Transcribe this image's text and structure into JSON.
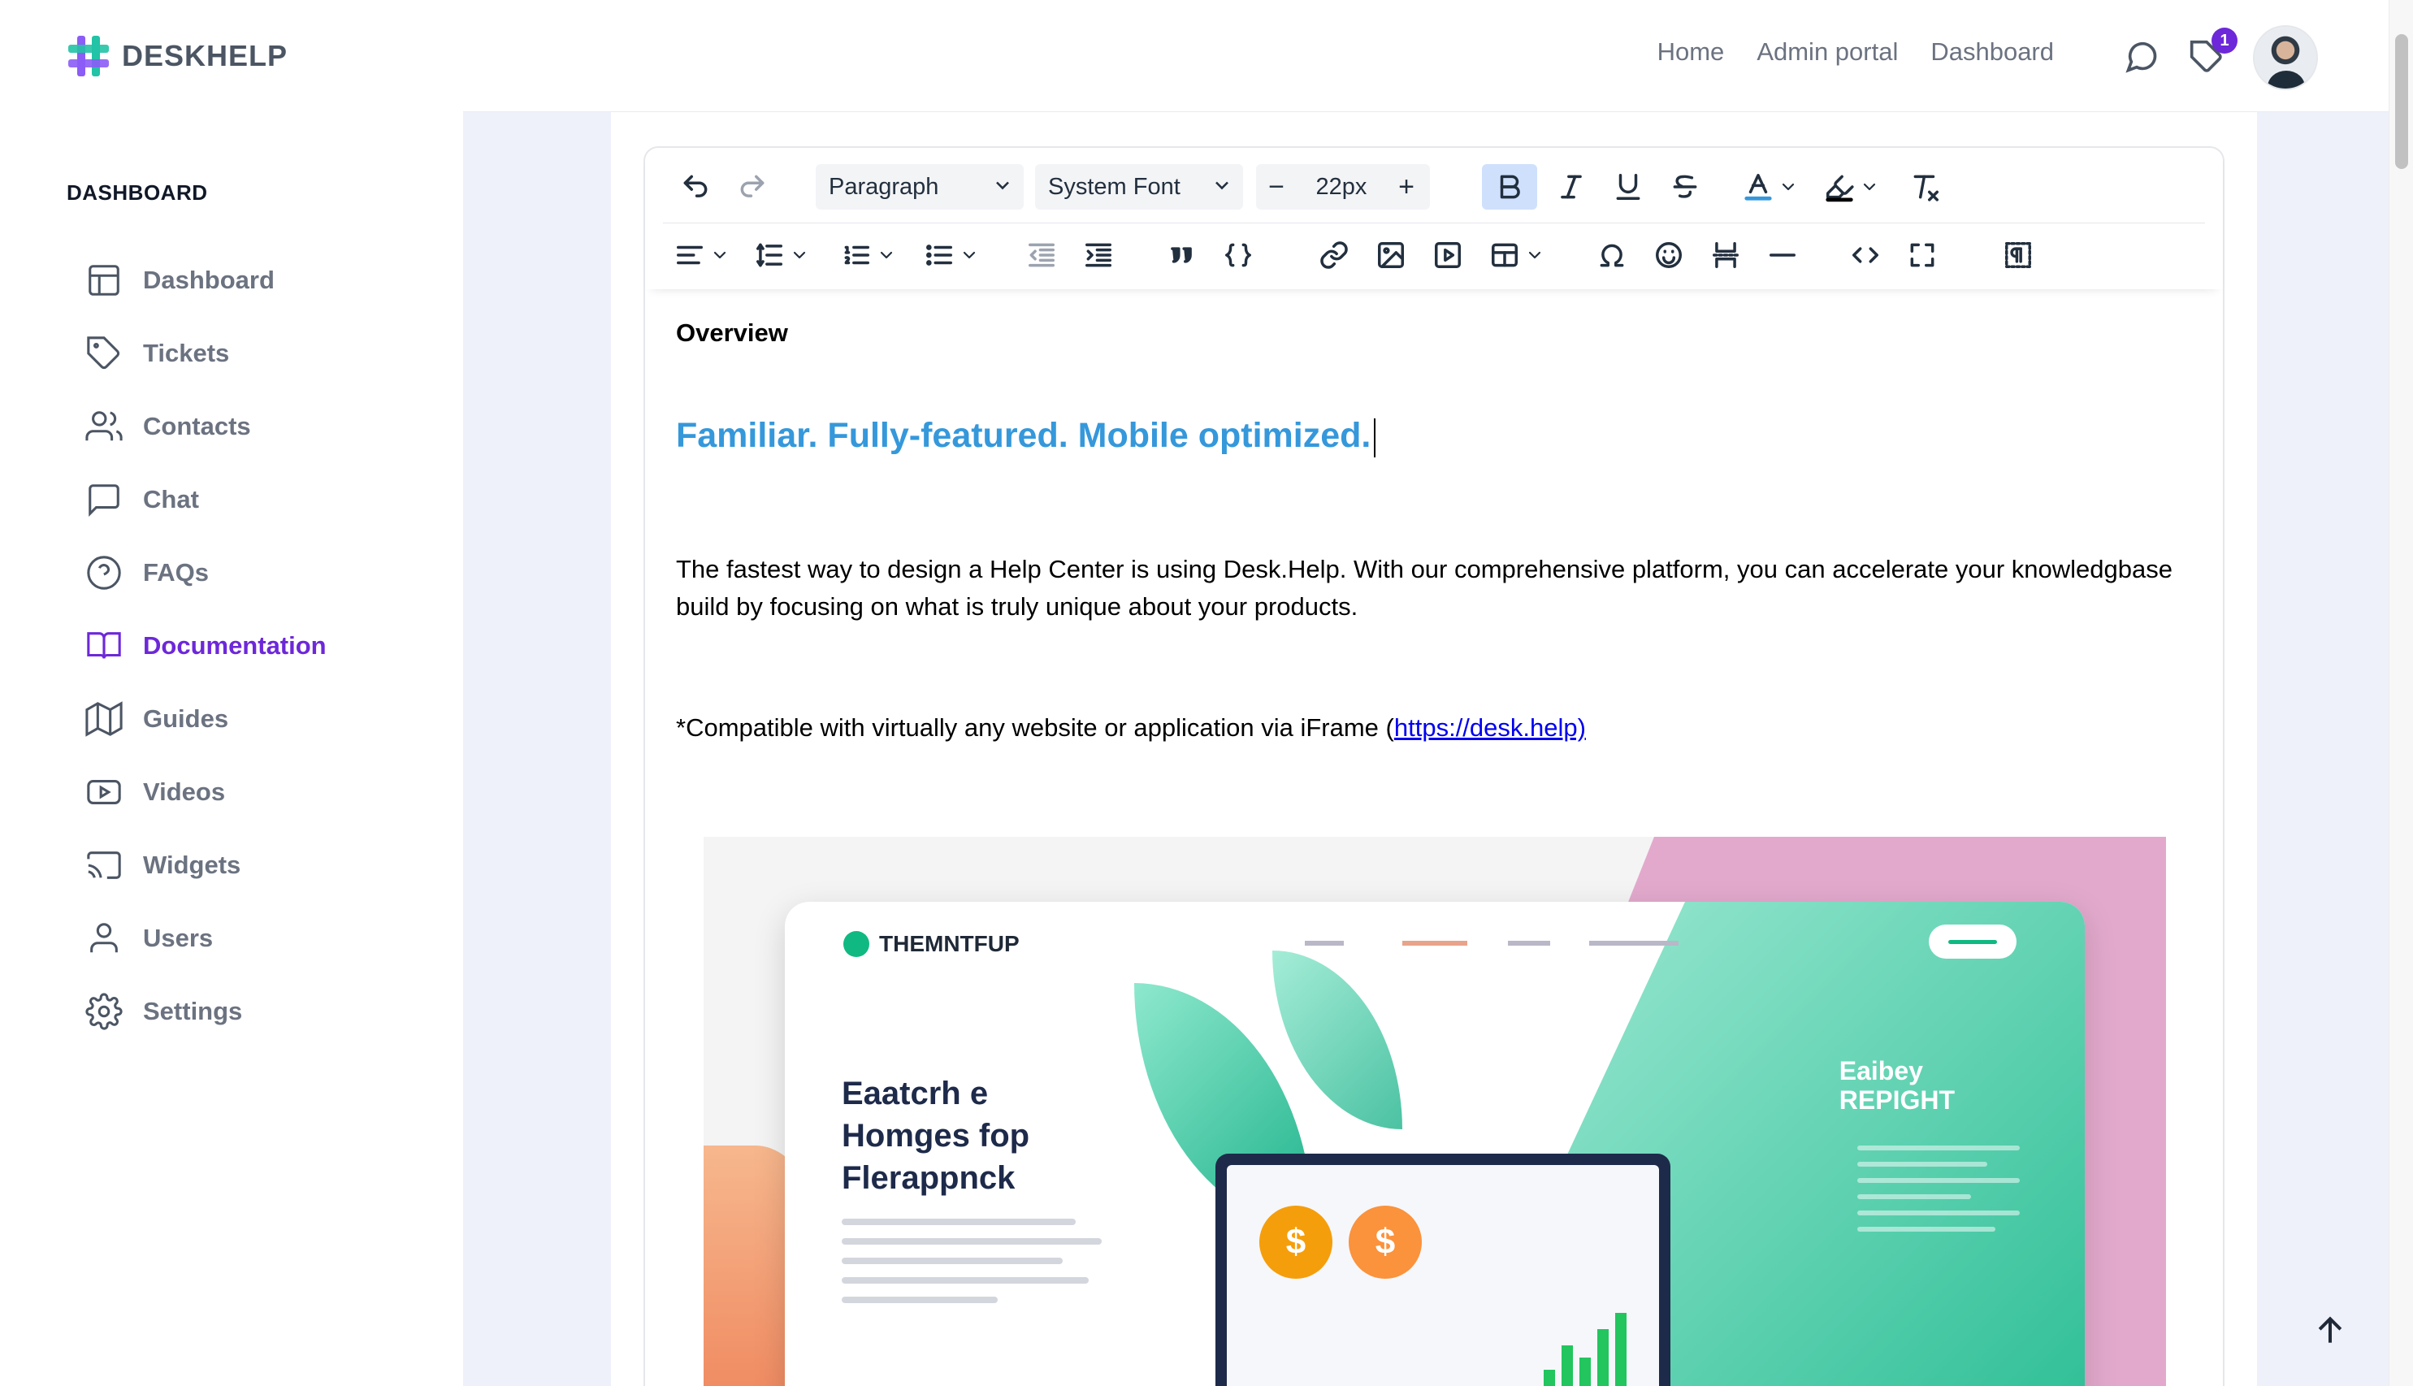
{
  "app": {
    "name": "DESKHELP"
  },
  "sidebar": {
    "heading": "DASHBOARD",
    "items": [
      {
        "label": "Dashboard",
        "icon": "layout-icon"
      },
      {
        "label": "Tickets",
        "icon": "tag-icon"
      },
      {
        "label": "Contacts",
        "icon": "users-icon"
      },
      {
        "label": "Chat",
        "icon": "chat-icon"
      },
      {
        "label": "FAQs",
        "icon": "question-icon"
      },
      {
        "label": "Documentation",
        "icon": "book-icon",
        "active": true
      },
      {
        "label": "Guides",
        "icon": "map-icon"
      },
      {
        "label": "Videos",
        "icon": "youtube-icon"
      },
      {
        "label": "Widgets",
        "icon": "cast-icon"
      },
      {
        "label": "Users",
        "icon": "user-icon"
      },
      {
        "label": "Settings",
        "icon": "gear-icon"
      }
    ]
  },
  "topbar": {
    "links": [
      "Home",
      "Admin portal",
      "Dashboard"
    ],
    "notification_count": "1"
  },
  "toolbar": {
    "block_format": "Paragraph",
    "font_family": "System Font",
    "font_size": "22px",
    "decrease_glyph": "−",
    "increase_glyph": "+"
  },
  "document": {
    "overview": "Overview",
    "headline": "Familiar. Fully-featured. Mobile optimized.",
    "paragraph": "The fastest way to design a Help Center is using Desk.Help. With our comprehensive platform, you can accelerate your knowledgbase build by focusing on what is truly unique about your products.",
    "compat_text": "*Compatible with virtually any website or application via iFrame (",
    "compat_link": "https://desk.help)"
  },
  "embedded_image": {
    "brand": "THEMNTFUP",
    "title_lines": [
      "Eaatcrh e",
      "Homges fop",
      "Flerappnck"
    ],
    "right_title_lines": [
      "Eaibey",
      "REPIGHT"
    ]
  },
  "colors": {
    "accent": "#6d28d9",
    "headline": "#3598db",
    "sidebar_text": "#6b7280",
    "link": "#0000ee",
    "bold_active_bg": "#cfe0fc"
  }
}
